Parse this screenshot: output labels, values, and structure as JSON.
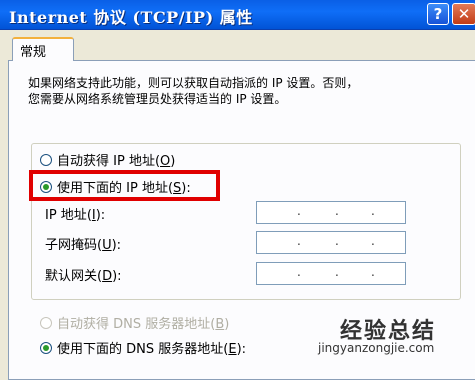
{
  "window": {
    "title": "Internet 协议 (TCP/IP) 属性",
    "help_glyph": "?",
    "close_glyph": "✕"
  },
  "tabs": [
    {
      "label": "常规",
      "selected": true
    }
  ],
  "description": {
    "line1": "如果网络支持此功能，则可以获取自动指派的 IP 设置。否则，",
    "line2": "您需要从网络系统管理员处获得适当的 IP 设置。"
  },
  "ip_options": {
    "auto": {
      "label": "自动获得 IP 地址",
      "key": "O",
      "selected": false
    },
    "manual": {
      "label": "使用下面的 IP 地址",
      "key": "S",
      "selected": true
    }
  },
  "fields": [
    {
      "label": "IP 地址",
      "key": "I",
      "value": ". . ."
    },
    {
      "label": "子网掩码",
      "key": "U",
      "value": ". . ."
    },
    {
      "label": "默认网关",
      "key": "D",
      "value": ". . ."
    }
  ],
  "dns_options": {
    "auto": {
      "label": "自动获得 DNS 服务器地址",
      "key": "B",
      "enabled": false
    },
    "manual": {
      "label": "使用下面的 DNS 服务器地址",
      "key": "E",
      "selected": true
    }
  },
  "watermark": {
    "main": "经验总结",
    "sub": "jingyanzongjie.com"
  },
  "colors": {
    "titlebar": "#0f6ef7",
    "highlight": "#e00000",
    "tab_accent": "#f3b13d"
  }
}
